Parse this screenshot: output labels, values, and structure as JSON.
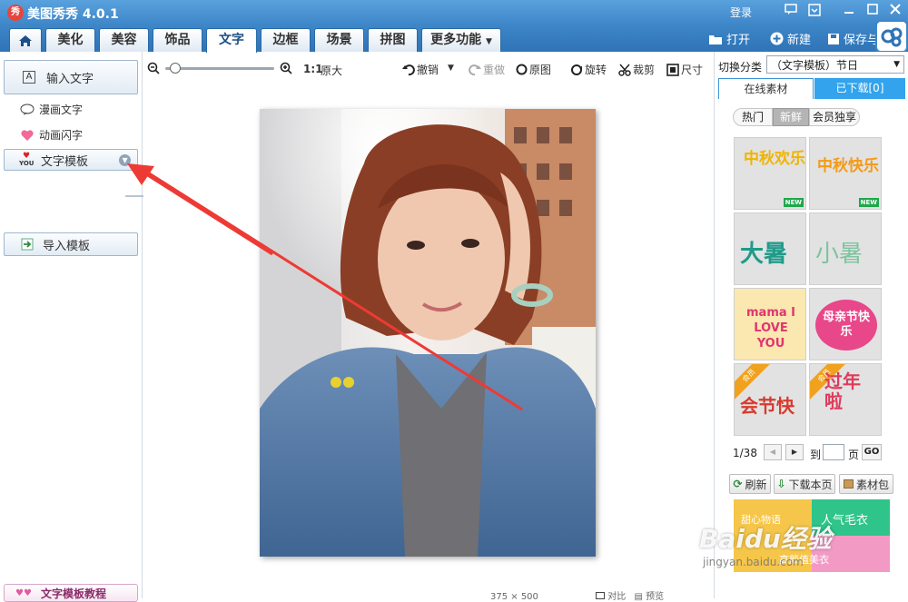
{
  "app": {
    "logo_char": "秀",
    "title": "美图秀秀 4.0.1",
    "login": "登录"
  },
  "tabs": [
    {
      "label": ""
    },
    {
      "label": "美化"
    },
    {
      "label": "美容"
    },
    {
      "label": "饰品"
    },
    {
      "label": "文字"
    },
    {
      "label": "边框"
    },
    {
      "label": "场景"
    },
    {
      "label": "拼图"
    },
    {
      "label": "更多功能"
    }
  ],
  "top_actions": {
    "open": "打开",
    "new": "新建",
    "save": "保存与分享"
  },
  "left_panel": {
    "input_text": "输入文字",
    "comic_text": "漫画文字",
    "anim_text": "动画闪字",
    "template": "文字模板",
    "import_template": "导入模板",
    "tutorial": "文字模板教程",
    "template_icon_text": "YOU"
  },
  "toolbar": {
    "ratio": "1:1",
    "original_size": "原大",
    "undo": "撤销",
    "redo": "重做",
    "original": "原图",
    "rotate": "旋转",
    "crop": "裁剪",
    "size": "尺寸",
    "zoom_level": 0.05
  },
  "status": {
    "dims": "375 × 500",
    "compare": "对比",
    "preview": "预览"
  },
  "right_panel": {
    "switch_label": "切换分类",
    "category_value": "（文字模板）节日",
    "tab_online": "在线素材",
    "tab_downloaded": "已下载[0]",
    "filters": [
      "热门",
      "新鲜",
      "会员独享"
    ],
    "active_filter": 1,
    "thumbs": [
      {
        "text": "中秋欢乐",
        "color": "#f0b400",
        "badge": "NEW"
      },
      {
        "text": "中秋快乐",
        "color": "#f59a14",
        "badge": "NEW"
      },
      {
        "text": "大暑",
        "color": "#1f9b8a",
        "badge": ""
      },
      {
        "text": "小暑",
        "color": "#7cc4a0",
        "badge": ""
      },
      {
        "text": "mama I LOVE YOU",
        "color": "#e0356e",
        "badge": ""
      },
      {
        "text": "母亲节快乐",
        "color": "#e8478a",
        "badge": ""
      },
      {
        "text": "会节快",
        "color": "#d83a2c",
        "badge": "会员"
      },
      {
        "text": "过年啦",
        "color": "#e03a5a",
        "badge": "会员"
      }
    ],
    "pager": {
      "page": "1/38",
      "goto": "到",
      "page_unit": "页",
      "go": "GO"
    },
    "actions": {
      "refresh": "刷新",
      "download_page": "下载本页",
      "pack": "素材包"
    },
    "banner": {
      "left_text": "甜心物语",
      "right_top": "人气毛衣",
      "bottom": "高颜值美衣"
    }
  },
  "watermark": {
    "line1": "Baidu经验",
    "line2": "jingyan.baidu.com"
  }
}
